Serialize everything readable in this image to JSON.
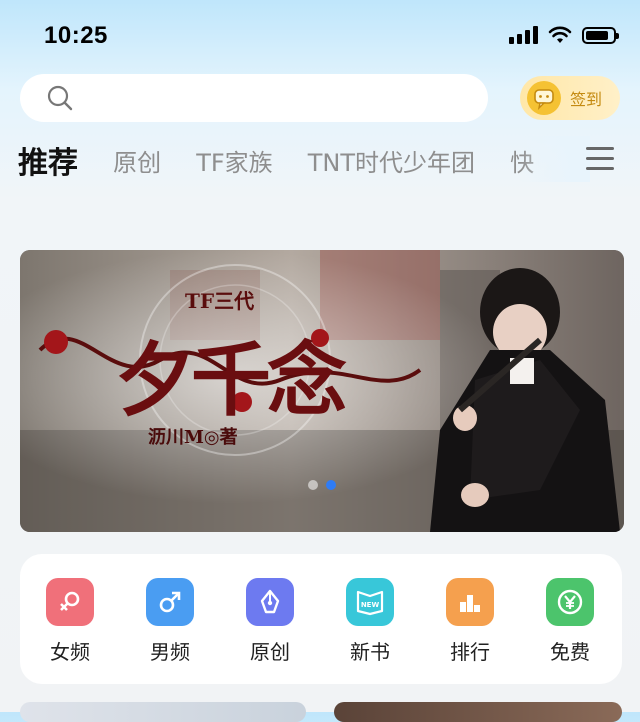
{
  "status_bar": {
    "time": "10:25",
    "battery_level": 0.85
  },
  "header": {
    "search": {
      "placeholder": "",
      "icon": "search-icon"
    },
    "checkin": {
      "label": "签到",
      "icon": "chat-bubble-icon"
    }
  },
  "tabs": [
    {
      "label": "推荐",
      "active": true
    },
    {
      "label": "原创",
      "active": false
    },
    {
      "label": "TF家族",
      "active": false
    },
    {
      "label": "TNT时代少年团",
      "active": false
    },
    {
      "label": "快",
      "active": false
    }
  ],
  "banner": {
    "series": "TF三代",
    "title": "夕千念",
    "author": "沥川M◎著",
    "slide_count": 2,
    "active_slide": 2
  },
  "quick_nav": [
    {
      "label": "女频",
      "icon": "female-icon",
      "color": "#f0707a"
    },
    {
      "label": "男频",
      "icon": "male-icon",
      "color": "#4a9df2"
    },
    {
      "label": "原创",
      "icon": "pen-nib-icon",
      "color": "#6d7af0"
    },
    {
      "label": "新书",
      "icon": "new-book-icon",
      "color": "#38c7d9"
    },
    {
      "label": "排行",
      "icon": "ranking-icon",
      "color": "#f5a04e"
    },
    {
      "label": "免费",
      "icon": "free-yen-icon",
      "color": "#4cc46c"
    }
  ]
}
